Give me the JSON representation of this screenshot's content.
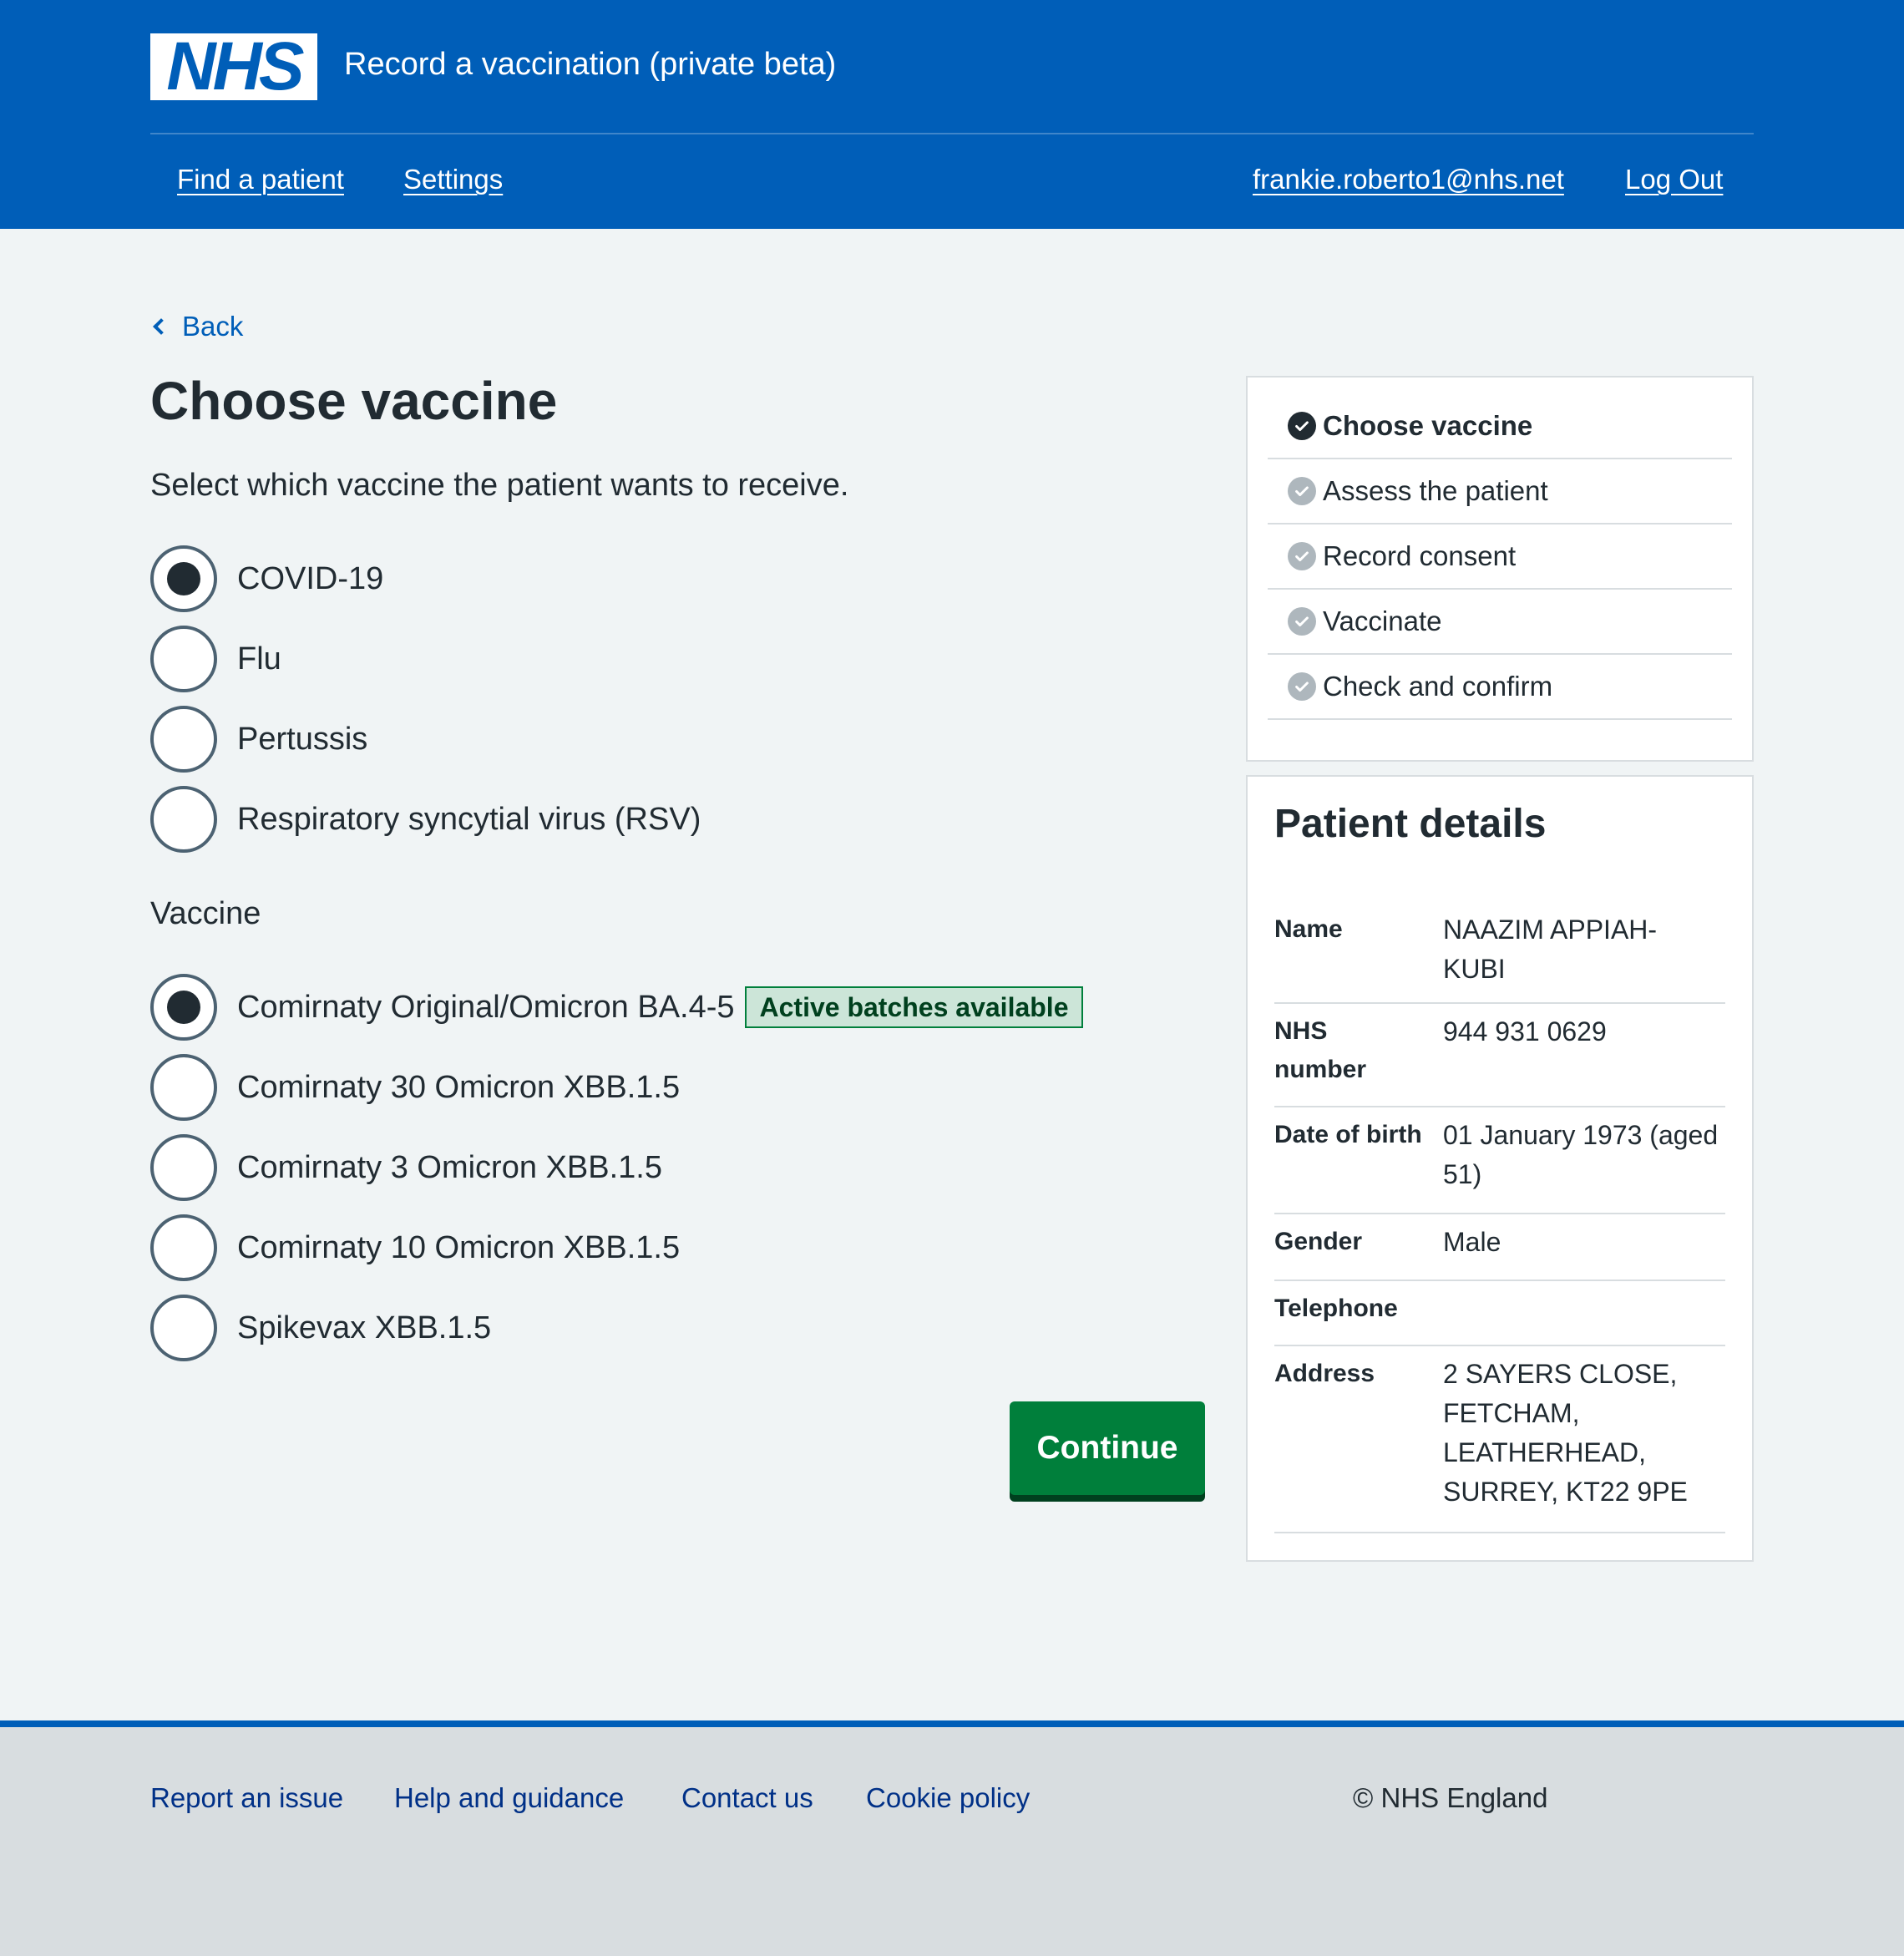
{
  "header": {
    "logo_text": "NHS",
    "service_name": "Record a vaccination (private beta)",
    "nav": {
      "find_patient": "Find a patient",
      "settings": "Settings",
      "user_email": "frankie.roberto1@nhs.net",
      "log_out": "Log Out"
    }
  },
  "back_link": "Back",
  "page": {
    "title": "Choose vaccine",
    "intro": "Select which vaccine the patient wants to receive.",
    "programmes": [
      {
        "label": "COVID-19",
        "checked": true
      },
      {
        "label": "Flu",
        "checked": false
      },
      {
        "label": "Pertussis",
        "checked": false
      },
      {
        "label": "Respiratory syncytial virus (RSV)",
        "checked": false
      }
    ],
    "vaccine_legend": "Vaccine",
    "vaccines": [
      {
        "label": "Comirnaty Original/Omicron BA.4-5",
        "checked": true,
        "tag": "Active batches available"
      },
      {
        "label": "Comirnaty 30 Omicron XBB.1.5",
        "checked": false
      },
      {
        "label": "Comirnaty 3 Omicron XBB.1.5",
        "checked": false
      },
      {
        "label": "Comirnaty 10 Omicron XBB.1.5",
        "checked": false
      },
      {
        "label": "Spikevax XBB.1.5",
        "checked": false
      }
    ],
    "continue_label": "Continue"
  },
  "task_list": [
    {
      "label": "Choose vaccine",
      "state": "current"
    },
    {
      "label": "Assess the patient",
      "state": "pending"
    },
    {
      "label": "Record consent",
      "state": "pending"
    },
    {
      "label": "Vaccinate",
      "state": "pending"
    },
    {
      "label": "Check and confirm",
      "state": "pending"
    }
  ],
  "patient_details": {
    "title": "Patient details",
    "rows": [
      {
        "key": "Name",
        "value": "NAAZIM APPIAH-KUBI"
      },
      {
        "key": "NHS number",
        "value": "944 931 0629"
      },
      {
        "key": "Date of birth",
        "value": "01 January 1973 (aged 51)"
      },
      {
        "key": "Gender",
        "value": "Male"
      },
      {
        "key": "Telephone",
        "value": ""
      },
      {
        "key": "Address",
        "value": "2 SAYERS CLOSE, FETCHAM, LEATHERHEAD, SURREY, KT22 9PE"
      }
    ]
  },
  "footer": {
    "links": [
      "Report an issue",
      "Help and guidance",
      "Contact us",
      "Cookie policy"
    ],
    "copyright": "© NHS England"
  },
  "colors": {
    "nhs_blue": "#005eb8",
    "button_green": "#007f3b",
    "text": "#212b32",
    "background": "#f0f4f5"
  }
}
